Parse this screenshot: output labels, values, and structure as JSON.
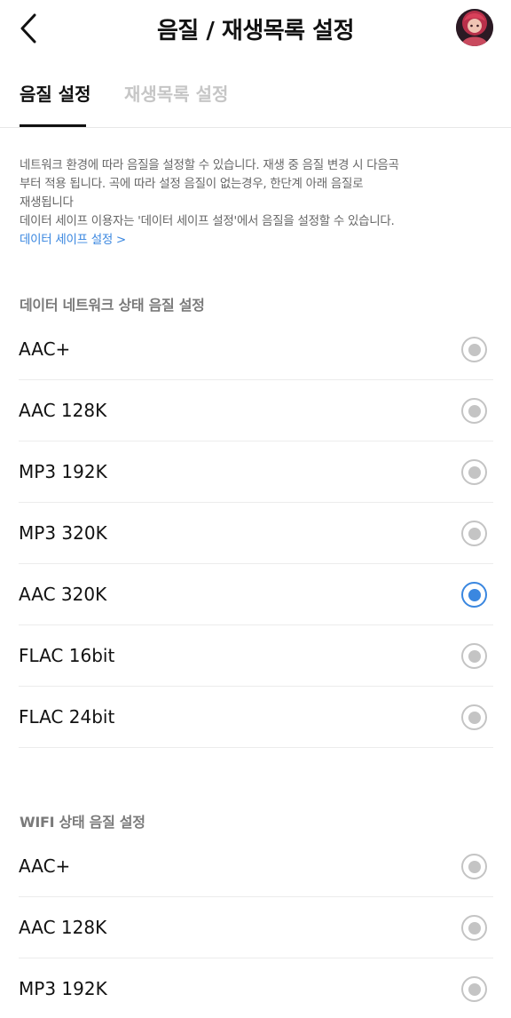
{
  "header": {
    "title": "음질 / 재생목록 설정",
    "icons": {
      "back": "chevron-left-icon",
      "avatar": "profile-avatar"
    }
  },
  "tabs": [
    {
      "label": "음질 설정",
      "active": true
    },
    {
      "label": "재생목록 설정",
      "active": false
    }
  ],
  "description": {
    "lines": [
      "네트워크 환경에 따라 음질을 설정할 수 있습니다. 재생 중 음질 변경 시 다음곡",
      "부터 적용 됩니다. 곡에 따라 설정 음질이 없는경우, 한단계 아래 음질로",
      "재생됩니다",
      "데이터 세이프 이용자는 '데이터 세이프 설정'에서 음질을 설정할 수 있습니다."
    ],
    "link": "데이터 세이프 설정 >"
  },
  "data_section": {
    "title": "데이터 네트워크 상태 음질 설정",
    "options": [
      {
        "label": "AAC+",
        "selected": false
      },
      {
        "label": "AAC 128K",
        "selected": false
      },
      {
        "label": "MP3 192K",
        "selected": false
      },
      {
        "label": "MP3 320K",
        "selected": false
      },
      {
        "label": "AAC 320K",
        "selected": true
      },
      {
        "label": "FLAC 16bit",
        "selected": false
      },
      {
        "label": "FLAC 24bit",
        "selected": false
      }
    ]
  },
  "wifi_section": {
    "title": "WIFI 상태 음질 설정",
    "options": [
      {
        "label": "AAC+",
        "selected": false
      },
      {
        "label": "AAC 128K",
        "selected": false
      },
      {
        "label": "MP3 192K",
        "selected": false
      }
    ]
  },
  "colors": {
    "accent": "#3a87e0",
    "radio_inactive": "#c4c4c4",
    "tab_inactive": "#c6c6c6",
    "section_title": "#7a7a7a",
    "description": "#666666"
  }
}
